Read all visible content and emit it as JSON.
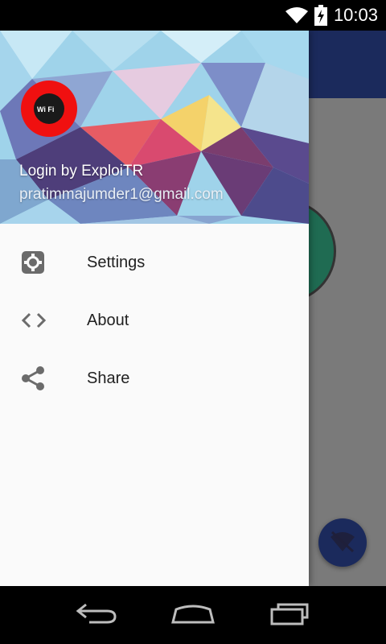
{
  "status_bar": {
    "time": "10:03",
    "icons": [
      "wifi-icon",
      "battery-charging-icon"
    ]
  },
  "drawer": {
    "header": {
      "avatar_icon": "wifi-logo-icon",
      "avatar_text": "Wi Fi",
      "user_name": "Login by ExploiTR",
      "user_email": "pratimmajumder1@gmail.com"
    },
    "menu": [
      {
        "label": "Settings",
        "icon": "gear-icon"
      },
      {
        "label": "About",
        "icon": "code-icon"
      },
      {
        "label": "Share",
        "icon": "share-icon"
      }
    ]
  },
  "app": {
    "fab_icon": "wifi-off-icon"
  },
  "nav_bar": {
    "buttons": [
      "back-icon",
      "home-icon",
      "recents-icon"
    ]
  },
  "colors": {
    "toolbar": "#1b2a5c",
    "avatar": "#f01010",
    "scrim": "#7a7a7a"
  }
}
